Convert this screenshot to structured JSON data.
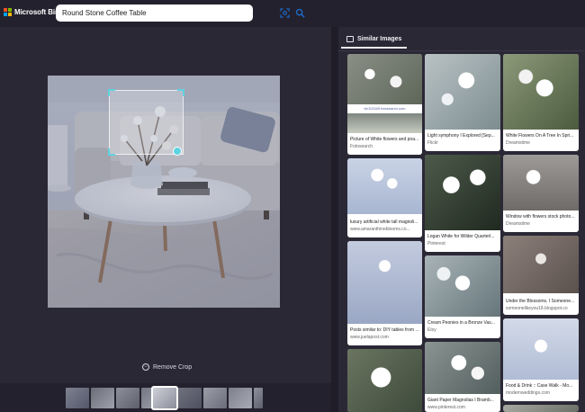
{
  "brand": {
    "name": "Microsoft Bing",
    "colors": [
      "#f25022",
      "#7fba00",
      "#00a4ef",
      "#ffb900"
    ]
  },
  "search": {
    "query": "Round Stone Coffee Table"
  },
  "icons": {
    "visual_search": "visual-search-icon",
    "search": "search-icon",
    "remove_crop": "remove-crop-icon",
    "tab": "image-icon"
  },
  "viewer": {
    "remove_crop_label": "Remove Crop"
  },
  "panel": {
    "tab_label": "Similar Images"
  },
  "results": [
    {
      "watermark": "fsr113169 fotosearch.com",
      "title": "Picture of White flowers and poa...",
      "source": "Fotosearch"
    },
    {
      "title": "Light symphony I Explored [Sep...",
      "source": "Flickr"
    },
    {
      "title": "White Flowers On A Tree In Spri...",
      "source": "Dreamstime"
    },
    {
      "title": "luxury artificial white tall magnoli...",
      "source": "www.amaranthineblooms.co..."
    },
    {
      "title": "Logan White for Wilder Quarterl...",
      "source": "Pinterest"
    },
    {
      "title": "Window with flowers stock photo...",
      "source": "Dreamstime"
    },
    {
      "title": "Posts similar to: DIY tables from ...",
      "source": "www.juelapost.com"
    },
    {
      "title": "Cream Peonies in a Bronze Vas...",
      "source": "Etsy"
    },
    {
      "title": "Under the Blossoms. I Someone...",
      "source": "someonelikeyou18.blogspot.co"
    },
    {
      "title": "Food & Drink :: Case Walk - Mo...",
      "source": "modernweddings.com"
    },
    {
      "title": "Giant Paper Magnolias I Bramb...",
      "source": "www.pinterest.com"
    }
  ]
}
